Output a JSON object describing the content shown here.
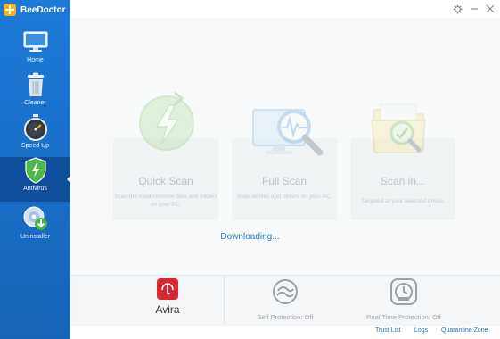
{
  "app": {
    "name": "BeeDoctor"
  },
  "sidebar": {
    "items": [
      {
        "label": "Home",
        "icon": "monitor-icon"
      },
      {
        "label": "Cleaner",
        "icon": "trash-icon"
      },
      {
        "label": "Speed Up",
        "icon": "stopwatch-icon"
      },
      {
        "label": "Antivirus",
        "icon": "shield-icon",
        "active": true
      },
      {
        "label": "Uninstaller",
        "icon": "disc-download-icon"
      }
    ]
  },
  "window": {
    "settings_icon": "gear-icon",
    "minimize_icon": "minimize-icon",
    "close_icon": "close-icon"
  },
  "scans": [
    {
      "title": "Quick Scan",
      "desc": "Scan the most common files and folders on your PC.",
      "icon": "lightning-icon"
    },
    {
      "title": "Full Scan",
      "desc": "Scan all files and folders on your PC.",
      "icon": "monitor-magnifier-icon"
    },
    {
      "title": "Scan in...",
      "desc": "Targeted at your selected drives.",
      "icon": "folder-magnifier-icon"
    }
  ],
  "status": {
    "text": "Downloading..."
  },
  "bottom": {
    "engine": {
      "name": "Avira",
      "icon": "avira-umbrella-icon"
    },
    "self_protection": {
      "label": "Self Protection: Off",
      "icon": "shield-off-icon"
    },
    "real_time": {
      "label": "Real Time Protection: Off",
      "icon": "clock-shield-icon"
    }
  },
  "footer": {
    "links": [
      "Trust List",
      "Logs",
      "Quarantine Zone"
    ]
  },
  "colors": {
    "sidebar": "#1a6fc9",
    "active": "#0f4f99",
    "accent_link": "#2a6fb8",
    "avira_red": "#d8272f"
  }
}
